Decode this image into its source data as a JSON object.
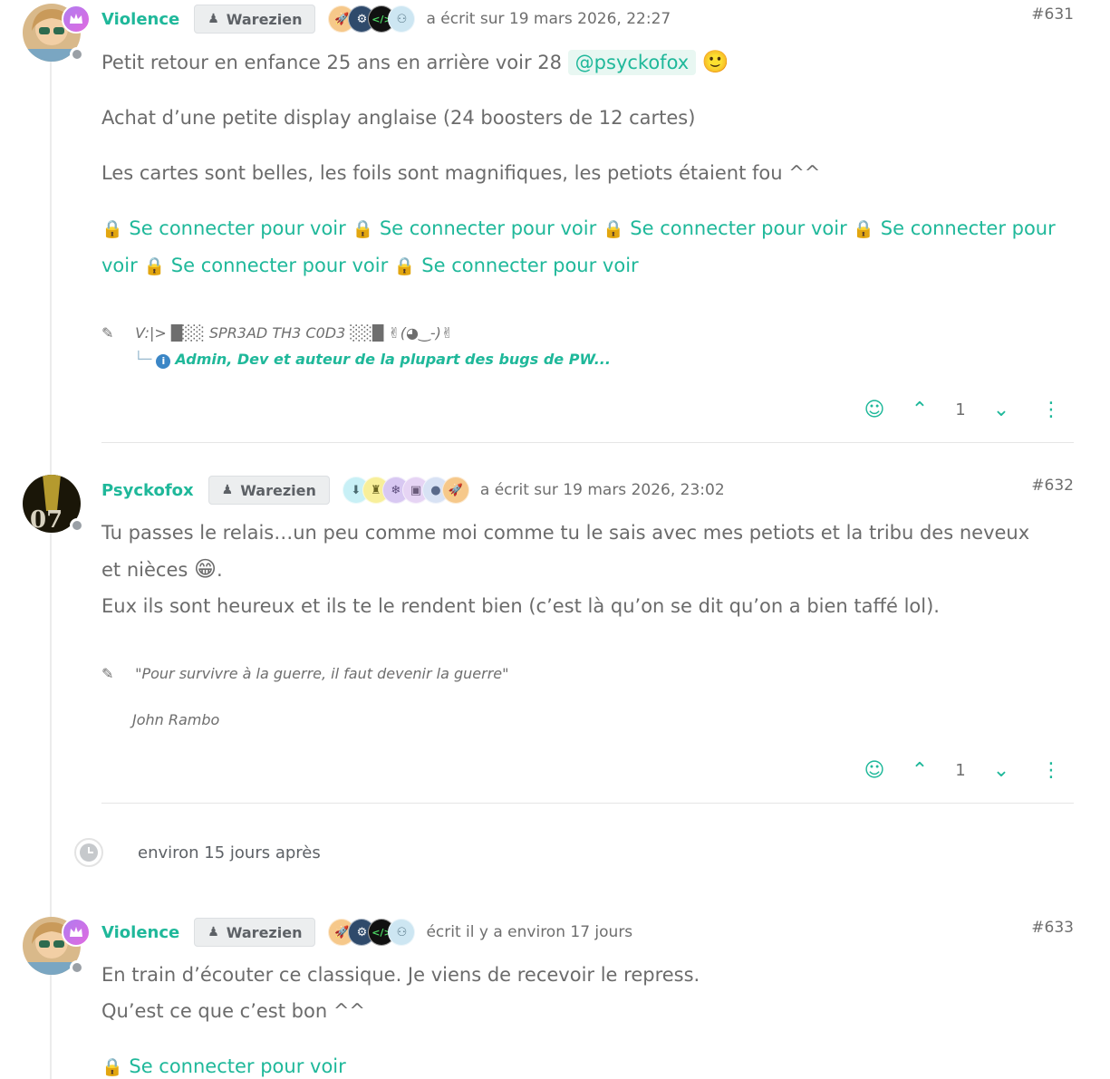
{
  "posts": [
    {
      "username": "Violence",
      "group": "Warezien",
      "posted": "a écrit sur 19 mars 2026, 22:27",
      "number": "#631",
      "line1_text": "Petit retour en enfance 25 ans en arrière voir 28",
      "mention": "@psyckofox",
      "line2": "Achat d’une petite display anglaise (24 boosters de 12 cartes)",
      "line3": "Les cartes sont belles, les foils sont magnifiques, les petiots étaient fou ^^",
      "login_links": [
        "Se connecter pour voir",
        "Se connecter pour voir",
        "Se connecter pour voir",
        "Se connecter pour voir",
        "Se connecter pour voir",
        "Se connecter pour voir"
      ],
      "signature_line1": "V:|> █░░ SPR3AD TH3 C0D3 ░░█ ✌(◕‿-)✌",
      "signature_line2": "Admin, Dev et auteur de la plupart des bugs de PW...",
      "vote_count": "1"
    },
    {
      "username": "Psyckofox",
      "group": "Warezien",
      "posted": "a écrit sur 19 mars 2026, 23:02",
      "number": "#632",
      "line1": "Tu passes le relais…un peu comme moi comme tu le sais avec mes petiots et la tribu des neveux",
      "line1b": "et nièces",
      "line2": "Eux ils sont heureux et ils te le rendent bien (c’est là qu’on se dit qu’on a bien taffé lol).",
      "signature_quote": "\"Pour survivre à la guerre, il faut devenir la guerre\"",
      "signature_author": "John Rambo",
      "vote_count": "1"
    },
    {
      "username": "Violence",
      "group": "Warezien",
      "posted": "écrit il y a environ 17 jours",
      "number": "#633",
      "line1": "En train d’écouter ce classique. Je viens de recevoir le repress.",
      "line2": "Qu’est ce que c’est bon ^^",
      "login_link": "Se connecter pour voir"
    }
  ],
  "time_gap": "environ 15 jours après",
  "colors": {
    "accent": "#1fb89a",
    "text": "#6b6b6b",
    "status_offline": "#9aa0a6"
  },
  "icons": [
    "crown-icon",
    "user-group-icon",
    "rocket-icon",
    "gears-icon",
    "code-icon",
    "users-icon",
    "lock-icon",
    "edit-signature-icon",
    "info-icon",
    "smile-icon",
    "upvote-icon",
    "downvote-icon",
    "more-icon",
    "clock-icon"
  ]
}
